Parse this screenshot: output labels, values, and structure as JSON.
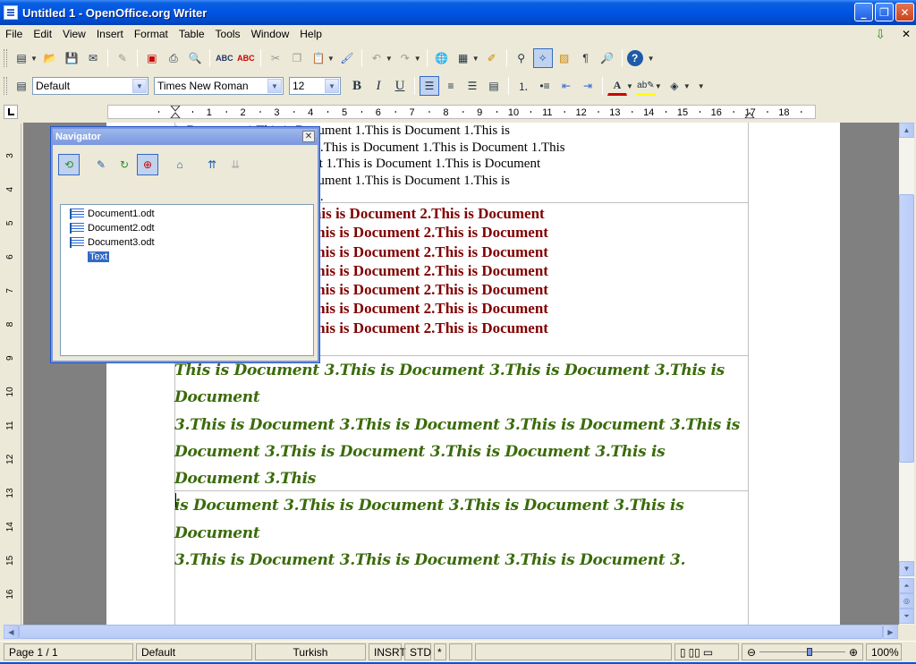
{
  "window": {
    "title": "Untitled 1 - OpenOffice.org Writer"
  },
  "menu": [
    "File",
    "Edit",
    "View",
    "Insert",
    "Format",
    "Table",
    "Tools",
    "Window",
    "Help"
  ],
  "toolbar2": {
    "paragraph_style": "Default",
    "font_name": "Times New Roman",
    "font_size": "12",
    "bold": "B",
    "italic": "I",
    "underline": "U"
  },
  "ruler": {
    "h_ticks": [
      "1",
      "2",
      "3",
      "4",
      "5",
      "6",
      "7",
      "8",
      "9",
      "10",
      "11",
      "12",
      "13",
      "14",
      "15",
      "16",
      "17",
      "18"
    ],
    "v_ticks": [
      "3",
      "4",
      "5",
      "6",
      "7",
      "8",
      "9",
      "10",
      "11",
      "12",
      "13",
      "14",
      "15",
      "16"
    ]
  },
  "documents": {
    "doc1_lines": [
      "is Document 1.This is Document 1.This is Document 1.This is",
      "ment 1.This is Document 1.This is Document 1.This is Document 1.This",
      "cument 1.This is Document 1.This is Document 1.This is Document",
      "is Document 1.This is Document 1.This is Document 1.This is",
      "ment 1.This is Document 1."
    ],
    "doc2_lines": [
      "This is Document 2.This is Document 2.This is Document",
      ".This is Document 2.This is Document 2.This is Document",
      ".This is Document 2.This is Document 2.This is Document",
      ".This is Document 2.This is Document 2.This is Document",
      ".This is Document 2.This is Document 2.This is Document",
      ".This is Document 2.This is Document 2.This is Document",
      ".This is Document 2.This is Document 2.This is Document",
      "."
    ],
    "doc3_lines": [
      "This is Document 3.This is Document 3.This is Document 3.This is Document",
      "3.This is Document 3.This is Document 3.This is Document 3.This is",
      "Document 3.This is Document 3.This is Document 3.This is Document 3.This",
      "is Document 3.This is Document 3.This is Document 3.This is Document",
      "3.This is Document 3.This is Document 3.This is Document 3."
    ]
  },
  "navigator": {
    "title": "Navigator",
    "entries": [
      "Document1.odt",
      "Document2.odt",
      "Document3.odt",
      "Text"
    ]
  },
  "statusbar": {
    "page": "Page 1 / 1",
    "style": "Default",
    "language": "Turkish",
    "insert_mode": "INSRT",
    "selection_mode": "STD",
    "modified": "*",
    "zoom": "100%"
  },
  "colors": {
    "doc2_text": "#800000",
    "doc3_text": "#3a6b0a",
    "selection": "#316ac5",
    "titlebar": "#0054e3"
  },
  "icons": [
    "document-icon",
    "new-icon",
    "open-icon",
    "save-icon",
    "email-icon",
    "edit-file-icon",
    "export-pdf-icon",
    "print-icon",
    "page-preview-icon",
    "spellcheck-icon",
    "autospellcheck-icon",
    "cut-icon",
    "copy-icon",
    "paste-icon",
    "clone-formatting-icon",
    "undo-icon",
    "redo-icon",
    "hyperlink-icon",
    "table-icon",
    "draw-functions-icon",
    "find-replace-icon",
    "navigator-icon",
    "gallery-icon",
    "formatting-marks-icon",
    "zoom-icon",
    "help-icon",
    "update-icon"
  ]
}
